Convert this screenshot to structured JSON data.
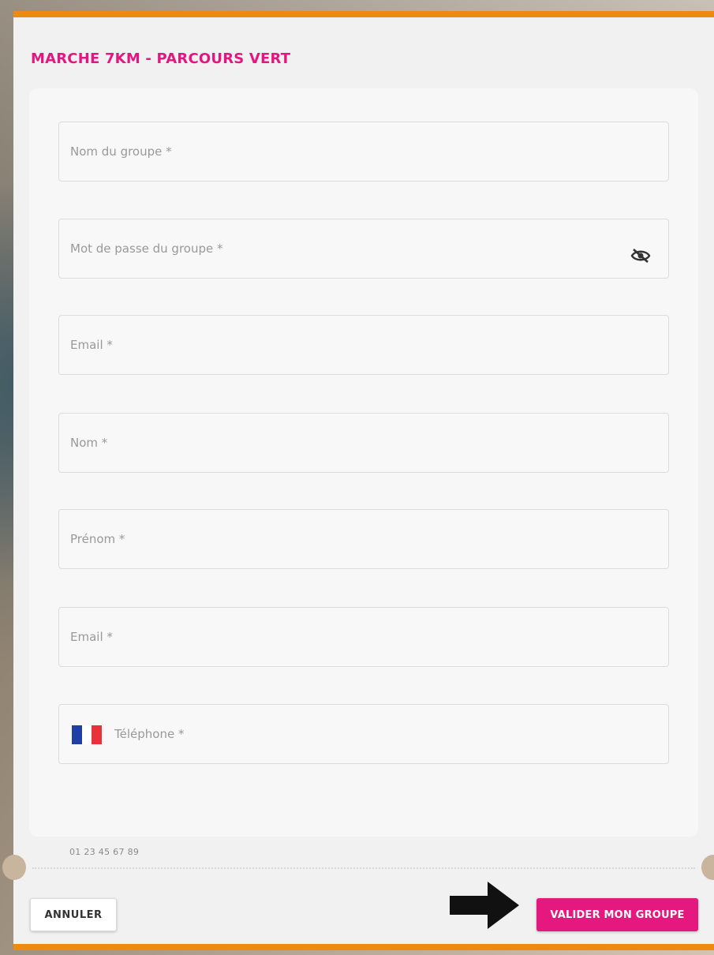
{
  "modal": {
    "title": "MARCHE 7KM - PARCOURS VERT",
    "accent_color": "#ee8a14",
    "title_color": "#e3177f"
  },
  "form": {
    "fields": [
      {
        "placeholder": "Nom du groupe *",
        "value": ""
      },
      {
        "placeholder": "Mot de passe du groupe *",
        "value": "",
        "icon": "eye-off-icon"
      },
      {
        "placeholder": "Email *",
        "value": ""
      },
      {
        "placeholder": "Nom *",
        "value": ""
      },
      {
        "placeholder": "Prénom *",
        "value": ""
      },
      {
        "placeholder": "Email *",
        "value": ""
      },
      {
        "placeholder": "Téléphone *",
        "value": "",
        "icon": "france-flag-icon"
      }
    ],
    "phone_hint": "01 23 45 67 89"
  },
  "actions": {
    "cancel_label": "ANNULER",
    "submit_label": "VALIDER MON GROUPE",
    "submit_color": "#e5187f"
  }
}
